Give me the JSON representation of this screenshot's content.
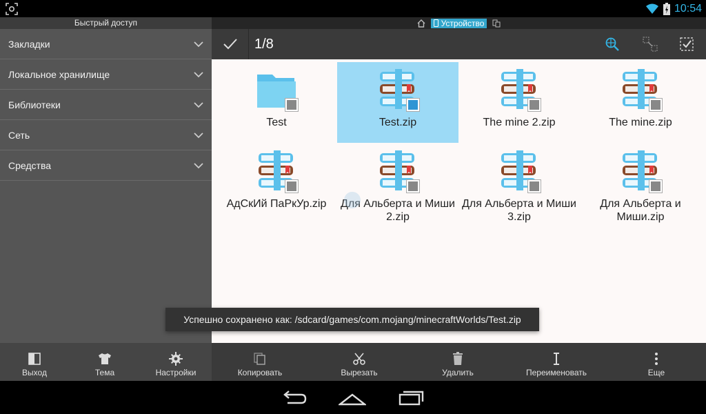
{
  "status_bar": {
    "time": "10:54"
  },
  "quick_access": {
    "title": "Быстрый доступ",
    "items": [
      {
        "label": "Закладки"
      },
      {
        "label": "Локальное хранилище"
      },
      {
        "label": "Библиотеки"
      },
      {
        "label": "Сеть"
      },
      {
        "label": "Средства"
      }
    ]
  },
  "location": {
    "label": "Устройство"
  },
  "toolbar": {
    "selection_count": "1/8"
  },
  "files": [
    {
      "name": "Test",
      "type": "folder",
      "selected": false
    },
    {
      "name": "Test.zip",
      "type": "zip",
      "selected": true
    },
    {
      "name": "The mine 2.zip",
      "type": "zip",
      "selected": false
    },
    {
      "name": "The mine.zip",
      "type": "zip",
      "selected": false
    },
    {
      "name": "АдСкИй ПаРкУр.zip",
      "type": "zip",
      "selected": false
    },
    {
      "name": "Для Альберта и Миши 2.zip",
      "type": "zip",
      "selected": false
    },
    {
      "name": "Для Альберта и Миши 3.zip",
      "type": "zip",
      "selected": false
    },
    {
      "name": "Для Альберта и Миши.zip",
      "type": "zip",
      "selected": false
    }
  ],
  "toast": {
    "message": "Успешно сохранено как: /sdcard/games/com.mojang/minecraftWorlds/Test.zip"
  },
  "bottom_actions": {
    "exit": "Выход",
    "theme": "Тема",
    "settings": "Настройки",
    "copy": "Копировать",
    "cut": "Вырезать",
    "delete": "Удалить",
    "rename": "Переименовать",
    "more": "Еще"
  },
  "colors": {
    "accent": "#33b5e5",
    "selection": "#9cdaf6",
    "sidebar_bg": "#555555",
    "toolbar_bg": "#3a3a3a",
    "content_bg": "#fdf9f8"
  }
}
